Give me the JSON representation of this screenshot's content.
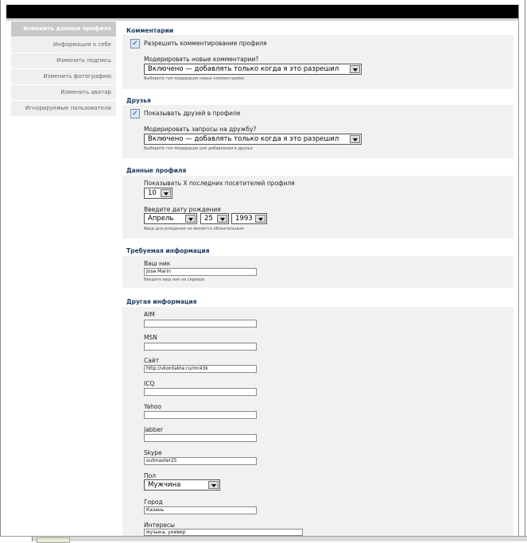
{
  "sidebar": {
    "items": [
      {
        "label": "Изменить данные профиля"
      },
      {
        "label": "Информация о себе"
      },
      {
        "label": "Изменить подпись"
      },
      {
        "label": "Изменить фотографию"
      },
      {
        "label": "Изменить аватар"
      },
      {
        "label": "Игнорируемые пользователи"
      }
    ]
  },
  "comments": {
    "title": "Комментарии",
    "allow_label": "Разрешить комментирование профиля",
    "moderate_label": "Модерировать новые комментарии?",
    "moderate_value": "Включено — добавлять только когда я это разрешил",
    "hint": "Выберите тип модерации новых комментариев"
  },
  "friends": {
    "title": "Друзья",
    "show_label": "Показывать друзей в профиле",
    "moderate_label": "Модерировать запросы на дружбу?",
    "moderate_value": "Включено — добавлять только когда я это разрешил",
    "hint": "Выберите тип модерации для добавления в друзья"
  },
  "profile": {
    "title": "Данные профиля",
    "visitors_label": "Показывать X последних посетителей профиля",
    "visitors_value": "10",
    "birth_label": "Введите дату рождения",
    "birth_month": "Апрель",
    "birth_day": "25",
    "birth_year": "1993",
    "birth_hint": "Ввод дня рождения не является обязательным"
  },
  "required": {
    "title": "Требуемая информация",
    "nick_label": "Ваш ник",
    "nick_value": "Jose Marin",
    "nick_hint": "Введите ваш ник на сервере"
  },
  "other": {
    "title": "Другая информация",
    "aim_label": "AIM",
    "aim_value": "",
    "msn_label": "MSN",
    "msn_value": "",
    "site_label": "Сайт",
    "site_value": "http://vkontakte.ru/mr43k",
    "icq_label": "ICQ",
    "icq_value": "",
    "yahoo_label": "Yahoo",
    "yahoo_value": "",
    "jabber_label": "Jabber",
    "jabber_value": "",
    "skype_label": "Skype",
    "skype_value": "outmaster25",
    "gender_label": "Пол",
    "gender_value": "Мужчина",
    "city_label": "Город",
    "city_value": "Казань",
    "interests_label": "Интересы",
    "interests_value": "музыка, универ"
  }
}
